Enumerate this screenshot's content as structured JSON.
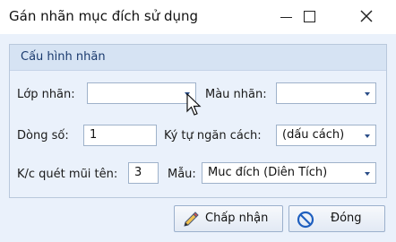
{
  "window": {
    "title": "Gán nhãn mục đích sử dụng"
  },
  "group": {
    "title": "Cấu hình nhãn"
  },
  "form": {
    "layer": {
      "label": "Lớp nhãn:",
      "value": ""
    },
    "color": {
      "label": "Màu nhãn:",
      "value": ""
    },
    "line": {
      "label": "Dòng số:",
      "value": "1"
    },
    "separator": {
      "label": "Ký tự ngăn cách:",
      "value": "(dấu cách)"
    },
    "arrow_distance": {
      "label": "K/c quét mũi tên:",
      "value": "3"
    },
    "template": {
      "label": "Mẫu:",
      "value": "Muc đích (Diên Tích)"
    }
  },
  "buttons": {
    "accept": "Chấp nhận",
    "close": "Đóng"
  },
  "icons": {
    "minimize": "minimize-icon",
    "maximize": "maximize-icon",
    "close": "close-icon",
    "pencil": "pencil-icon",
    "cancel": "cancel-icon",
    "cursor": "mouse-cursor-icon"
  },
  "colors": {
    "panel_bg": "#eaf1fb",
    "group_header_bg": "#d6e3f3",
    "group_title": "#1a3a6e",
    "field_border": "#9fb2ca",
    "dropdown_arrow": "#2a4d87",
    "cancel_icon": "#1f5fbf"
  }
}
